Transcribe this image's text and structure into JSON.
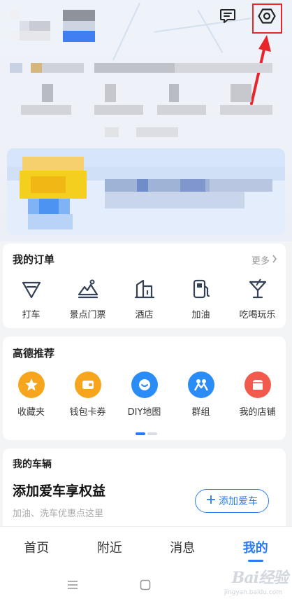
{
  "orders": {
    "title": "我的订单",
    "more": "更多",
    "items": [
      {
        "label": "打车",
        "icon": "taxi-icon"
      },
      {
        "label": "景点门票",
        "icon": "scenic-ticket-icon"
      },
      {
        "label": "酒店",
        "icon": "hotel-icon"
      },
      {
        "label": "加油",
        "icon": "fuel-icon"
      },
      {
        "label": "吃喝玩乐",
        "icon": "cocktail-icon"
      }
    ]
  },
  "recommend": {
    "title": "高德推荐",
    "items": [
      {
        "label": "收藏夹",
        "icon": "star-icon",
        "color": "#f7a51c"
      },
      {
        "label": "钱包卡券",
        "icon": "wallet-icon",
        "color": "#f7a51c"
      },
      {
        "label": "DIY地图",
        "icon": "diy-map-icon",
        "color": "#2a8cf6"
      },
      {
        "label": "群组",
        "icon": "group-icon",
        "color": "#2a8cf6"
      },
      {
        "label": "我的店铺",
        "icon": "shop-icon",
        "color": "#f25a4e"
      }
    ]
  },
  "vehicle": {
    "title": "我的车辆",
    "headline": "添加爱车享权益",
    "subtitle": "加油、洗车优惠点这里",
    "add_button": "添加爱车"
  },
  "tabs": [
    {
      "label": "首页",
      "active": false
    },
    {
      "label": "附近",
      "active": false
    },
    {
      "label": "消息",
      "active": false
    },
    {
      "label": "我的",
      "active": true
    }
  ],
  "watermark": {
    "text": "Bai经验",
    "sub": "jingyan.baidu.com"
  },
  "colors": {
    "accent": "#2a7cf6",
    "highlight": "#e8252a"
  }
}
